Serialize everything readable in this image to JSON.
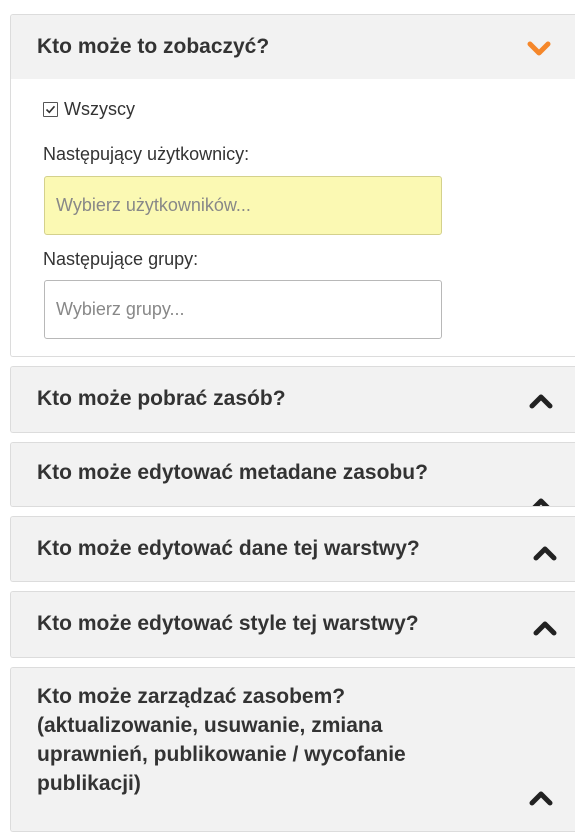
{
  "colors": {
    "accent_orange": "#f5872a",
    "chevron_dark": "#222222",
    "panel_bg": "#f2f2f2",
    "highlight_input": "#fbf9b3"
  },
  "view_panel": {
    "title": "Kto może to zobaczyć?",
    "expanded": true,
    "chevron_icon": "chevron-down-icon",
    "everyone_checked": true,
    "everyone_label": "Wszyscy",
    "users_label": "Następujący użytkownicy:",
    "users_placeholder": "Wybierz użytkowników...",
    "groups_label": "Następujące grupy:",
    "groups_placeholder": "Wybierz grupy..."
  },
  "collapsed_panels": [
    {
      "title": "Kto może pobrać zasób?",
      "chevron_icon": "chevron-up-icon"
    },
    {
      "title": "Kto może edytować metadane zasobu?",
      "chevron_icon": "chevron-up-icon"
    },
    {
      "title": "Kto może edytować dane tej warstwy?",
      "chevron_icon": "chevron-up-icon"
    },
    {
      "title": "Kto może edytować style tej warstwy?",
      "chevron_icon": "chevron-up-icon"
    }
  ],
  "manage_panel": {
    "title_lines": [
      "Kto może zarządzać zasobem?",
      "(aktualizowanie, usuwanie, zmiana",
      "uprawnień, publikowanie / wycofanie",
      "publikacji)"
    ],
    "chevron_icon": "chevron-up-icon"
  }
}
